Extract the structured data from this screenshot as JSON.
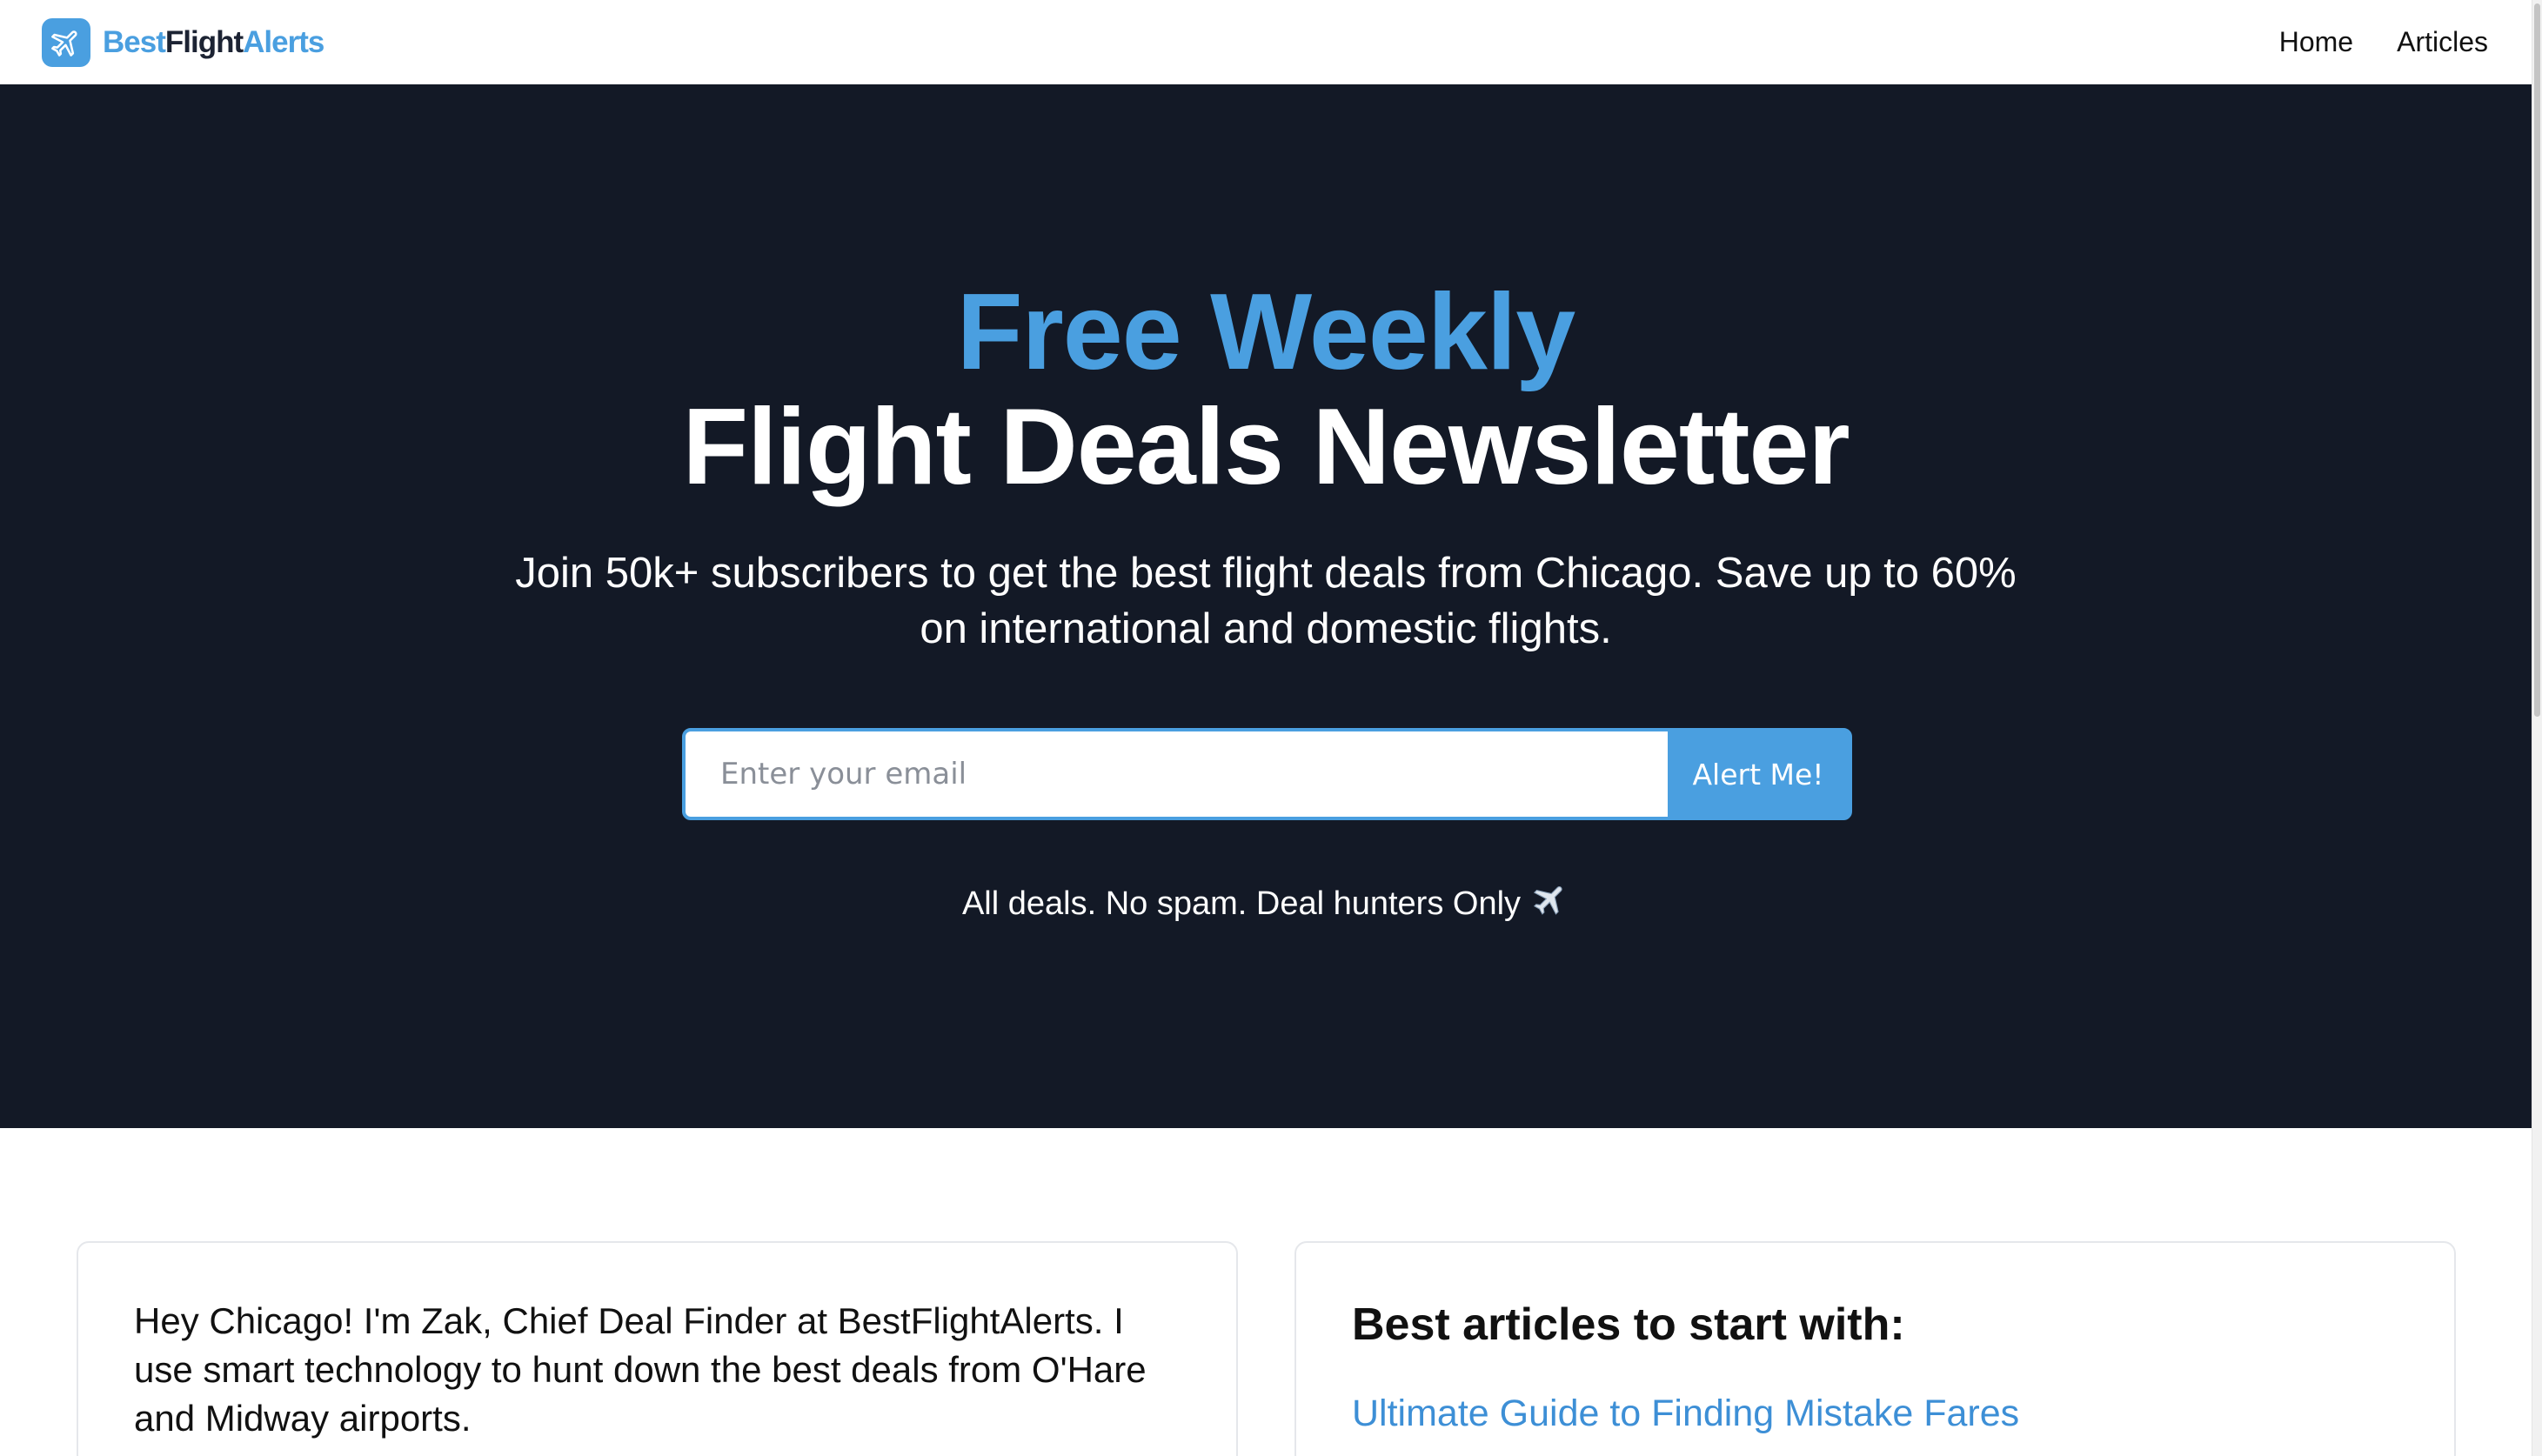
{
  "brand": {
    "name_part1": "Best",
    "name_part2": "Flight",
    "name_part3": "Alerts",
    "accent_color": "#4a9fe0",
    "logo_icon": "airplane-icon"
  },
  "nav": {
    "items": [
      {
        "label": "Home"
      },
      {
        "label": "Articles"
      }
    ]
  },
  "hero": {
    "title_line1": "Free Weekly",
    "title_line2": "Flight Deals Newsletter",
    "subtitle": "Join 50k+ subscribers to get the best flight deals from Chicago. Save up to 60% on international and domestic flights.",
    "email_placeholder": "Enter your email",
    "button_label": "Alert Me!",
    "tagline": "All deals. No spam. Deal hunters Only",
    "tagline_icon": "airplane-icon",
    "background_color": "#131926"
  },
  "intro_card": {
    "text": "Hey Chicago! I'm Zak, Chief Deal Finder at BestFlightAlerts. I use smart technology to hunt down the best deals from O'Hare and Midway airports."
  },
  "articles_card": {
    "heading": "Best articles to start with:",
    "links": [
      {
        "label": "Ultimate Guide to Finding Mistake Fares"
      }
    ]
  }
}
